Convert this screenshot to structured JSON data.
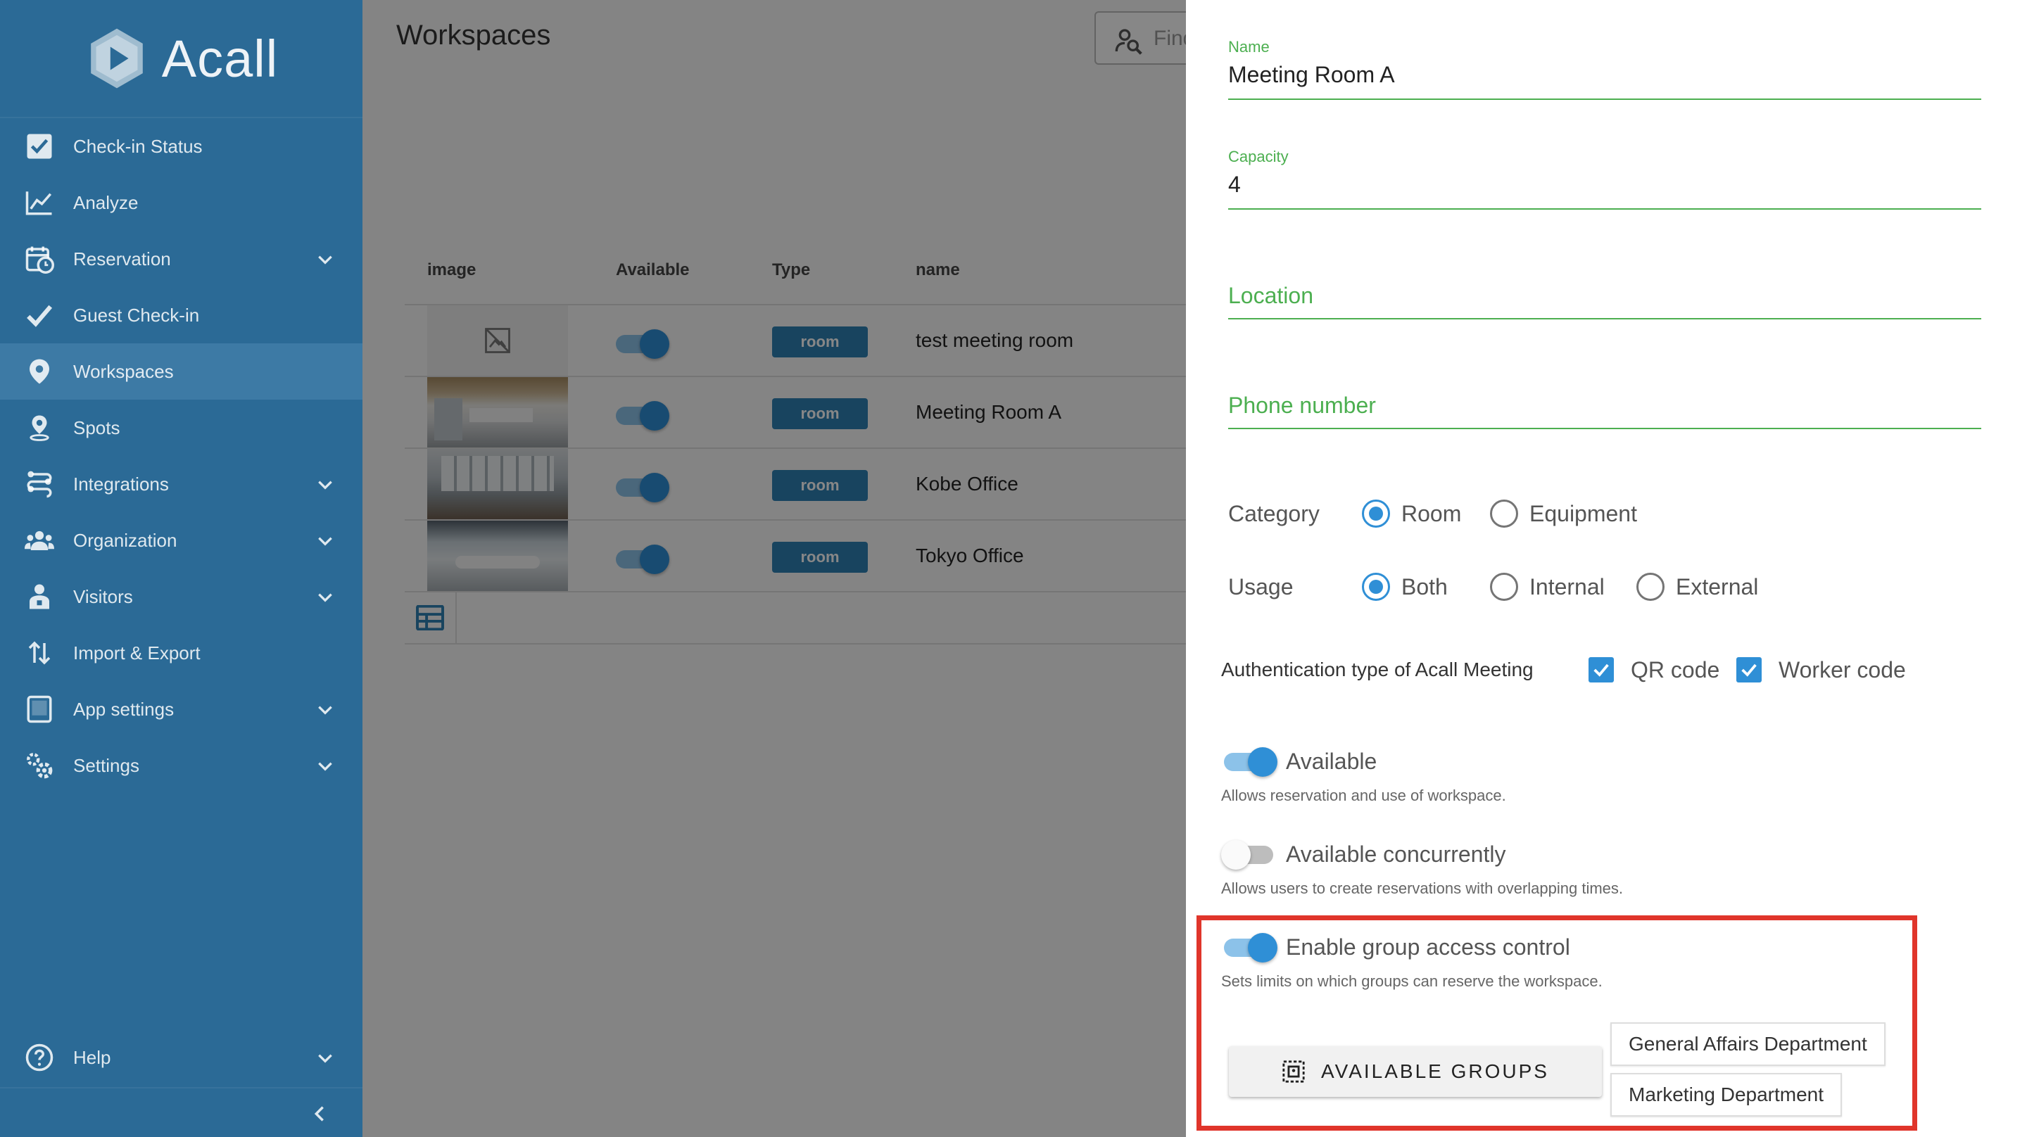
{
  "app": {
    "logo_text": "Acall"
  },
  "sidebar": {
    "items": [
      {
        "label": "Check-in Status",
        "icon": "checkbox-icon",
        "has_chevron": false
      },
      {
        "label": "Analyze",
        "icon": "chart-line-icon",
        "has_chevron": false
      },
      {
        "label": "Reservation",
        "icon": "calendar-clock-icon",
        "has_chevron": true
      },
      {
        "label": "Guest Check-in",
        "icon": "check-icon",
        "has_chevron": false
      },
      {
        "label": "Workspaces",
        "icon": "location-pin-icon",
        "has_chevron": false,
        "active": true
      },
      {
        "label": "Spots",
        "icon": "pin-icon",
        "has_chevron": false
      },
      {
        "label": "Integrations",
        "icon": "integrations-icon",
        "has_chevron": true
      },
      {
        "label": "Organization",
        "icon": "people-group-icon",
        "has_chevron": true
      },
      {
        "label": "Visitors",
        "icon": "visitor-icon",
        "has_chevron": true
      },
      {
        "label": "Import & Export",
        "icon": "sort-arrows-icon",
        "has_chevron": false
      },
      {
        "label": "App settings",
        "icon": "tablet-icon",
        "has_chevron": true
      },
      {
        "label": "Settings",
        "icon": "gears-icon",
        "has_chevron": true
      }
    ],
    "help_label": "Help"
  },
  "main": {
    "title": "Workspaces",
    "search_placeholder": "Find",
    "table": {
      "headers": {
        "image": "image",
        "available": "Available",
        "type": "Type",
        "name": "name"
      },
      "rows": [
        {
          "type": "room",
          "name": "test meeting room",
          "available": true,
          "has_image": false
        },
        {
          "type": "room",
          "name": "Meeting Room A",
          "available": true,
          "has_image": true
        },
        {
          "type": "room",
          "name": "Kobe Office",
          "available": true,
          "has_image": true
        },
        {
          "type": "room",
          "name": "Tokyo Office",
          "available": true,
          "has_image": true
        }
      ]
    }
  },
  "panel": {
    "name_label": "Name",
    "name_value": "Meeting Room A",
    "capacity_label": "Capacity",
    "capacity_value": "4",
    "location_label": "Location",
    "phone_label": "Phone number",
    "category": {
      "label": "Category",
      "options": [
        "Room",
        "Equipment"
      ],
      "selected": "Room"
    },
    "usage": {
      "label": "Usage",
      "options": [
        "Both",
        "Internal",
        "External"
      ],
      "selected": "Both"
    },
    "auth": {
      "label": "Authentication type of Acall Meeting",
      "qr_label": "QR code",
      "qr_checked": true,
      "worker_label": "Worker code",
      "worker_checked": true
    },
    "available": {
      "title": "Available",
      "description": "Allows reservation and use of workspace.",
      "on": true
    },
    "concurrent": {
      "title": "Available concurrently",
      "description": "Allows users to create reservations with overlapping times.",
      "on": false
    },
    "group_access": {
      "title": "Enable group access control",
      "description": "Sets limits on which groups can reserve the workspace.",
      "on": true
    },
    "groups_button": "AVAILABLE GROUPS",
    "groups": [
      "General Affairs Department",
      "Marketing Department"
    ]
  },
  "colors": {
    "sidebar": "#2b6a96",
    "accent": "#2f8fd6",
    "field_green": "#4caf50",
    "highlight": "#e0352b",
    "badge": "#2f80b4"
  }
}
